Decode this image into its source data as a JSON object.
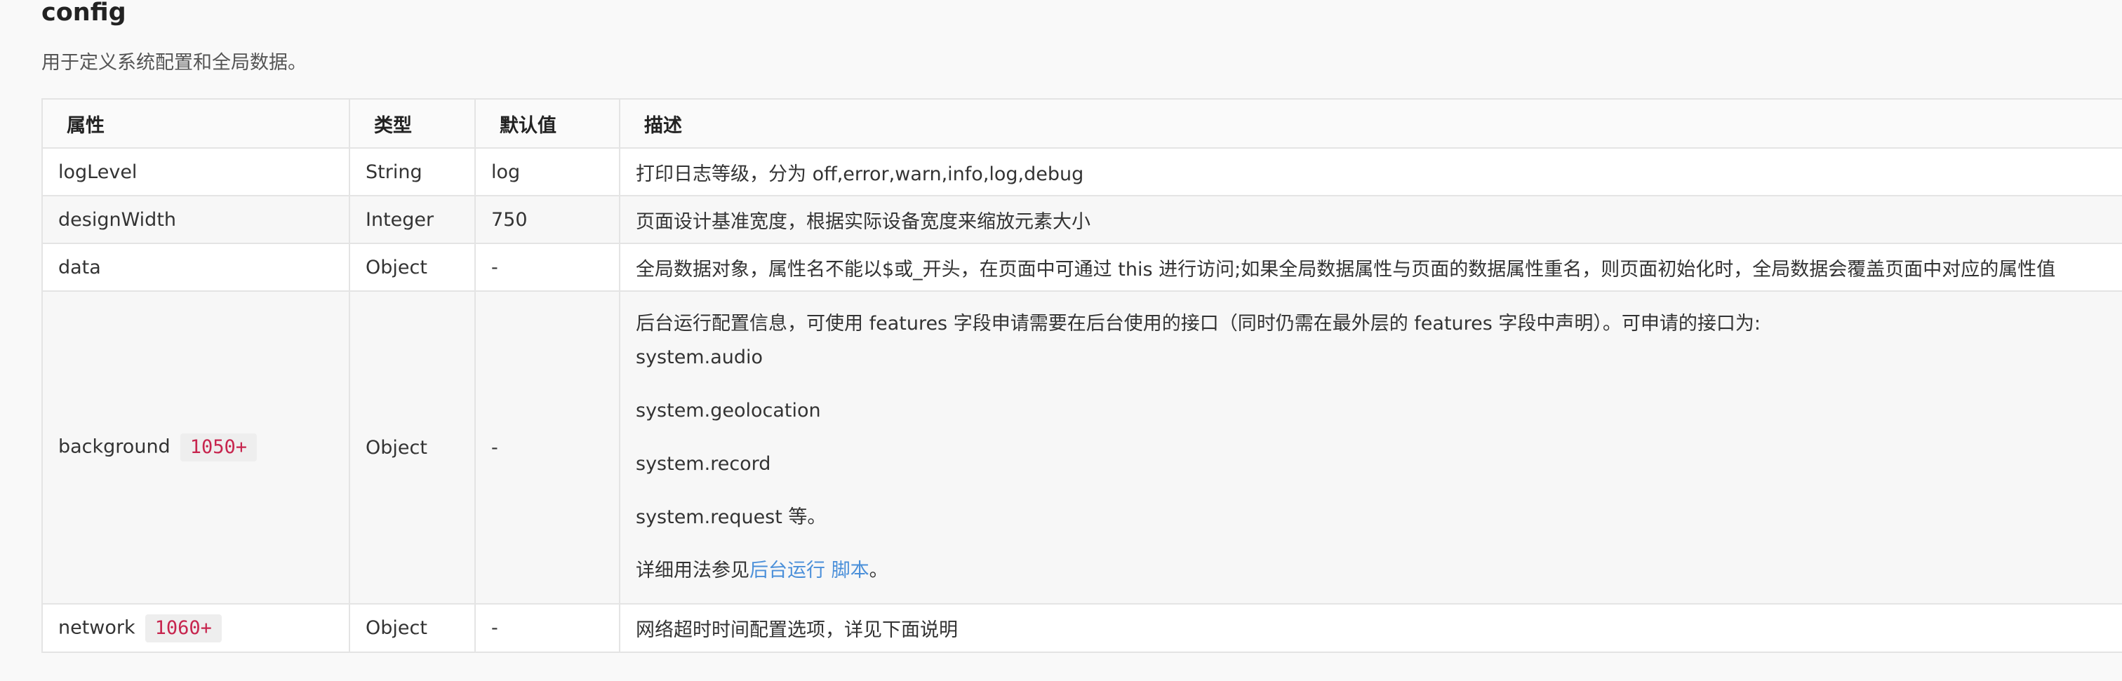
{
  "title": "config",
  "intro": "用于定义系统配置和全局数据。",
  "table": {
    "headers": [
      "属性",
      "类型",
      "默认值",
      "描述"
    ],
    "rows": [
      {
        "name": "logLevel",
        "type": "String",
        "default": "log",
        "desc": "打印日志等级，分为 off,error,warn,info,log,debug"
      },
      {
        "name": "designWidth",
        "type": "Integer",
        "default": "750",
        "desc": "页面设计基准宽度，根据实际设备宽度来缩放元素大小"
      },
      {
        "name": "data",
        "type": "Object",
        "default": "-",
        "desc": "全局数据对象，属性名不能以$或_开头，在页面中可通过 this 进行访问;如果全局数据属性与页面的数据属性重名，则页面初始化时，全局数据会覆盖页面中对应的属性值"
      },
      {
        "name": "background",
        "badge": "1050+",
        "type": "Object",
        "default": "-",
        "desc_intro": "后台运行配置信息，可使用 features 字段申请需要在后台使用的接口（同时仍需在最外层的 features 字段中声明）。可申请的接口为:",
        "apis": [
          "system.audio",
          "system.geolocation",
          "system.record",
          "system.request 等。"
        ],
        "note_prefix": "详细用法参见",
        "note_link": "后台运行 脚本",
        "note_suffix": "。"
      },
      {
        "name": "network",
        "badge": "1060+",
        "type": "Object",
        "default": "-",
        "desc": "网络超时时间配置选项，详见下面说明"
      }
    ]
  },
  "colors": {
    "link": "#4a8fd9",
    "badge_text": "#c7254e",
    "badge_bg": "#eeeeee"
  }
}
